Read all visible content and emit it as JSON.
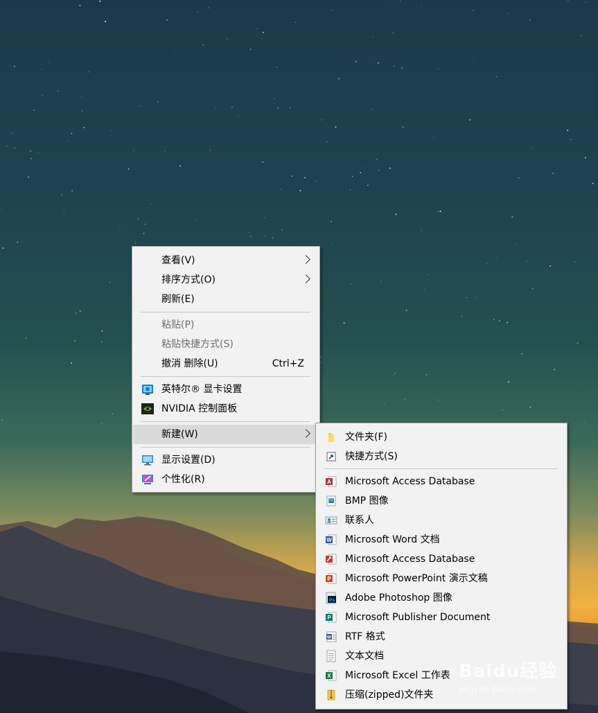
{
  "context_menu": {
    "items": [
      {
        "label": "查看(V)"
      },
      {
        "label": "排序方式(O)"
      },
      {
        "label": "刷新(E)"
      },
      {
        "label": "粘贴(P)"
      },
      {
        "label": "粘贴快捷方式(S)"
      },
      {
        "label": "撤消 删除(U)",
        "shortcut": "Ctrl+Z"
      },
      {
        "label": "英特尔® 显卡设置"
      },
      {
        "label": "NVIDIA 控制面板"
      },
      {
        "label": "新建(W)"
      },
      {
        "label": "显示设置(D)"
      },
      {
        "label": "个性化(R)"
      }
    ]
  },
  "new_submenu": {
    "items": [
      {
        "label": "文件夹(F)",
        "icon": "folder-icon"
      },
      {
        "label": "快捷方式(S)",
        "icon": "shortcut-icon"
      },
      {
        "label": "Microsoft Access Database",
        "icon": "access-icon"
      },
      {
        "label": "BMP 图像",
        "icon": "bmp-image-icon"
      },
      {
        "label": "联系人",
        "icon": "contact-icon"
      },
      {
        "label": "Microsoft Word 文档",
        "icon": "word-icon"
      },
      {
        "label": "Microsoft Access Database",
        "icon": "access-icon"
      },
      {
        "label": "Microsoft PowerPoint 演示文稿",
        "icon": "powerpoint-icon"
      },
      {
        "label": "Adobe Photoshop 图像",
        "icon": "photoshop-icon"
      },
      {
        "label": "Microsoft Publisher Document",
        "icon": "publisher-icon"
      },
      {
        "label": "RTF 格式",
        "icon": "rtf-icon"
      },
      {
        "label": "文本文档",
        "icon": "text-document-icon"
      },
      {
        "label": "Microsoft Excel 工作表",
        "icon": "excel-icon"
      },
      {
        "label": "压缩(zipped)文件夹",
        "icon": "zip-folder-icon"
      }
    ]
  },
  "watermark": {
    "brand": "Baidu经验",
    "url": "jingyan.baidu.com"
  }
}
